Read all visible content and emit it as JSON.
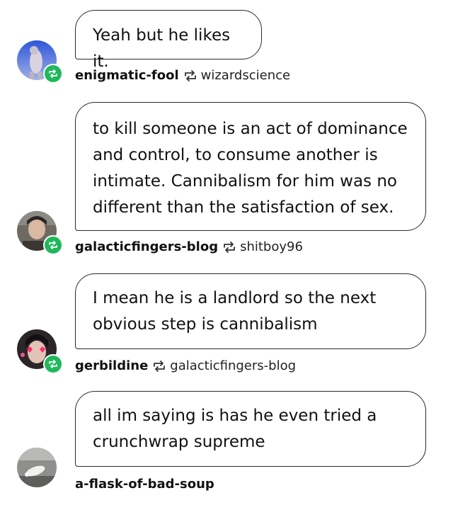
{
  "posts": [
    {
      "text": "Yeah but he likes it.",
      "username": "enigmatic-fool",
      "reblogged_from": "wizardscience",
      "avatar_icon": "rat-figure-avatar"
    },
    {
      "text": "to kill someone is an act of dominance and control, to consume another is intimate. Cannibalism for him was no different than the satisfaction of sex.",
      "username": "galacticfingers-blog",
      "reblogged_from": "shitboy96",
      "avatar_icon": "person-photo-avatar"
    },
    {
      "text": "I mean he is a landlord so the next obvious step is cannibalism",
      "username": "gerbildine",
      "reblogged_from": "galacticfingers-blog",
      "avatar_icon": "person-hearts-avatar"
    },
    {
      "text": "all im saying is has he even tried a crunchwrap supreme",
      "username": "a-flask-of-bad-soup",
      "avatar_icon": "bird-photo-avatar"
    }
  ],
  "colors": {
    "reblog_badge": "#1fb85a",
    "bubble_border": "#2a2a2a"
  }
}
